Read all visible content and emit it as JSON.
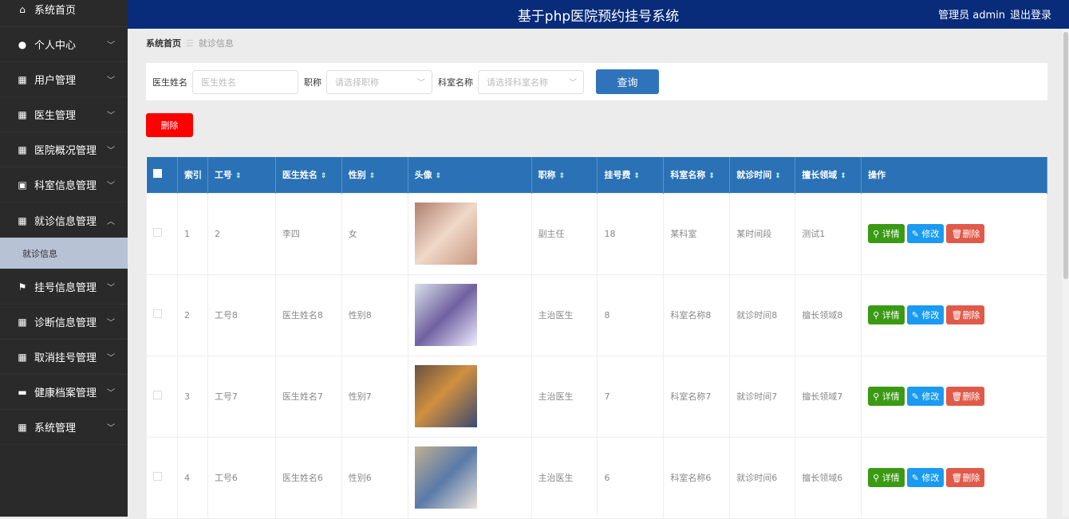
{
  "header": {
    "title": "基于php医院预约挂号系统",
    "user": "管理员 admin",
    "logout": "退出登录"
  },
  "sidebar": {
    "items": [
      {
        "label": "系统首页",
        "icon": "home-icon",
        "chev": false
      },
      {
        "label": "个人中心",
        "icon": "user-icon",
        "chev": true
      },
      {
        "label": "用户管理",
        "icon": "grid-icon",
        "chev": true
      },
      {
        "label": "医生管理",
        "icon": "grid-icon",
        "chev": true
      },
      {
        "label": "医院概况管理",
        "icon": "grid-icon",
        "chev": true
      },
      {
        "label": "科室信息管理",
        "icon": "clipboard-icon",
        "chev": true
      },
      {
        "label": "就诊信息管理",
        "icon": "grid-icon",
        "chev": true,
        "open": true
      },
      {
        "label": "挂号信息管理",
        "icon": "flag-icon",
        "chev": true
      },
      {
        "label": "诊断信息管理",
        "icon": "grid-icon",
        "chev": true
      },
      {
        "label": "取消挂号管理",
        "icon": "grid-icon",
        "chev": true
      },
      {
        "label": "健康档案管理",
        "icon": "briefcase-icon",
        "chev": true
      },
      {
        "label": "系统管理",
        "icon": "grid-icon",
        "chev": true
      }
    ],
    "sub": "就诊信息"
  },
  "breadcrumb": {
    "home": "系统首页",
    "sep": "☰",
    "current": "就诊信息"
  },
  "search": {
    "name_label": "医生姓名",
    "name_ph": "医生姓名",
    "title_label": "职称",
    "title_ph": "请选择职称",
    "dept_label": "科室名称",
    "dept_ph": "请选择科室名称",
    "query": "查询"
  },
  "delete_label": "删除",
  "table": {
    "headers": [
      "索引",
      "工号",
      "医生姓名",
      "性别",
      "头像",
      "职称",
      "挂号费",
      "科室名称",
      "就诊时间",
      "擅长领域",
      "操作"
    ],
    "rows": [
      [
        "1",
        "2",
        "李四",
        "女",
        "",
        "副主任",
        "18",
        "某科室",
        "某时间段",
        "测试1"
      ],
      [
        "2",
        "工号8",
        "医生姓名8",
        "性别8",
        "",
        "主治医生",
        "8",
        "科室名称8",
        "就诊时间8",
        "擅长领域8"
      ],
      [
        "3",
        "工号7",
        "医生姓名7",
        "性别7",
        "",
        "主治医生",
        "7",
        "科室名称7",
        "就诊时间7",
        "擅长领域7"
      ],
      [
        "4",
        "工号6",
        "医生姓名6",
        "性别6",
        "",
        "主治医生",
        "6",
        "科室名称6",
        "就诊时间6",
        "擅长领域6"
      ]
    ],
    "actions": {
      "detail": "详情",
      "edit": "修改",
      "delete": "删除"
    }
  },
  "colors": {
    "detail": "#3a9a13",
    "edit": "#1a9af0",
    "delete": "#e05a4a"
  }
}
